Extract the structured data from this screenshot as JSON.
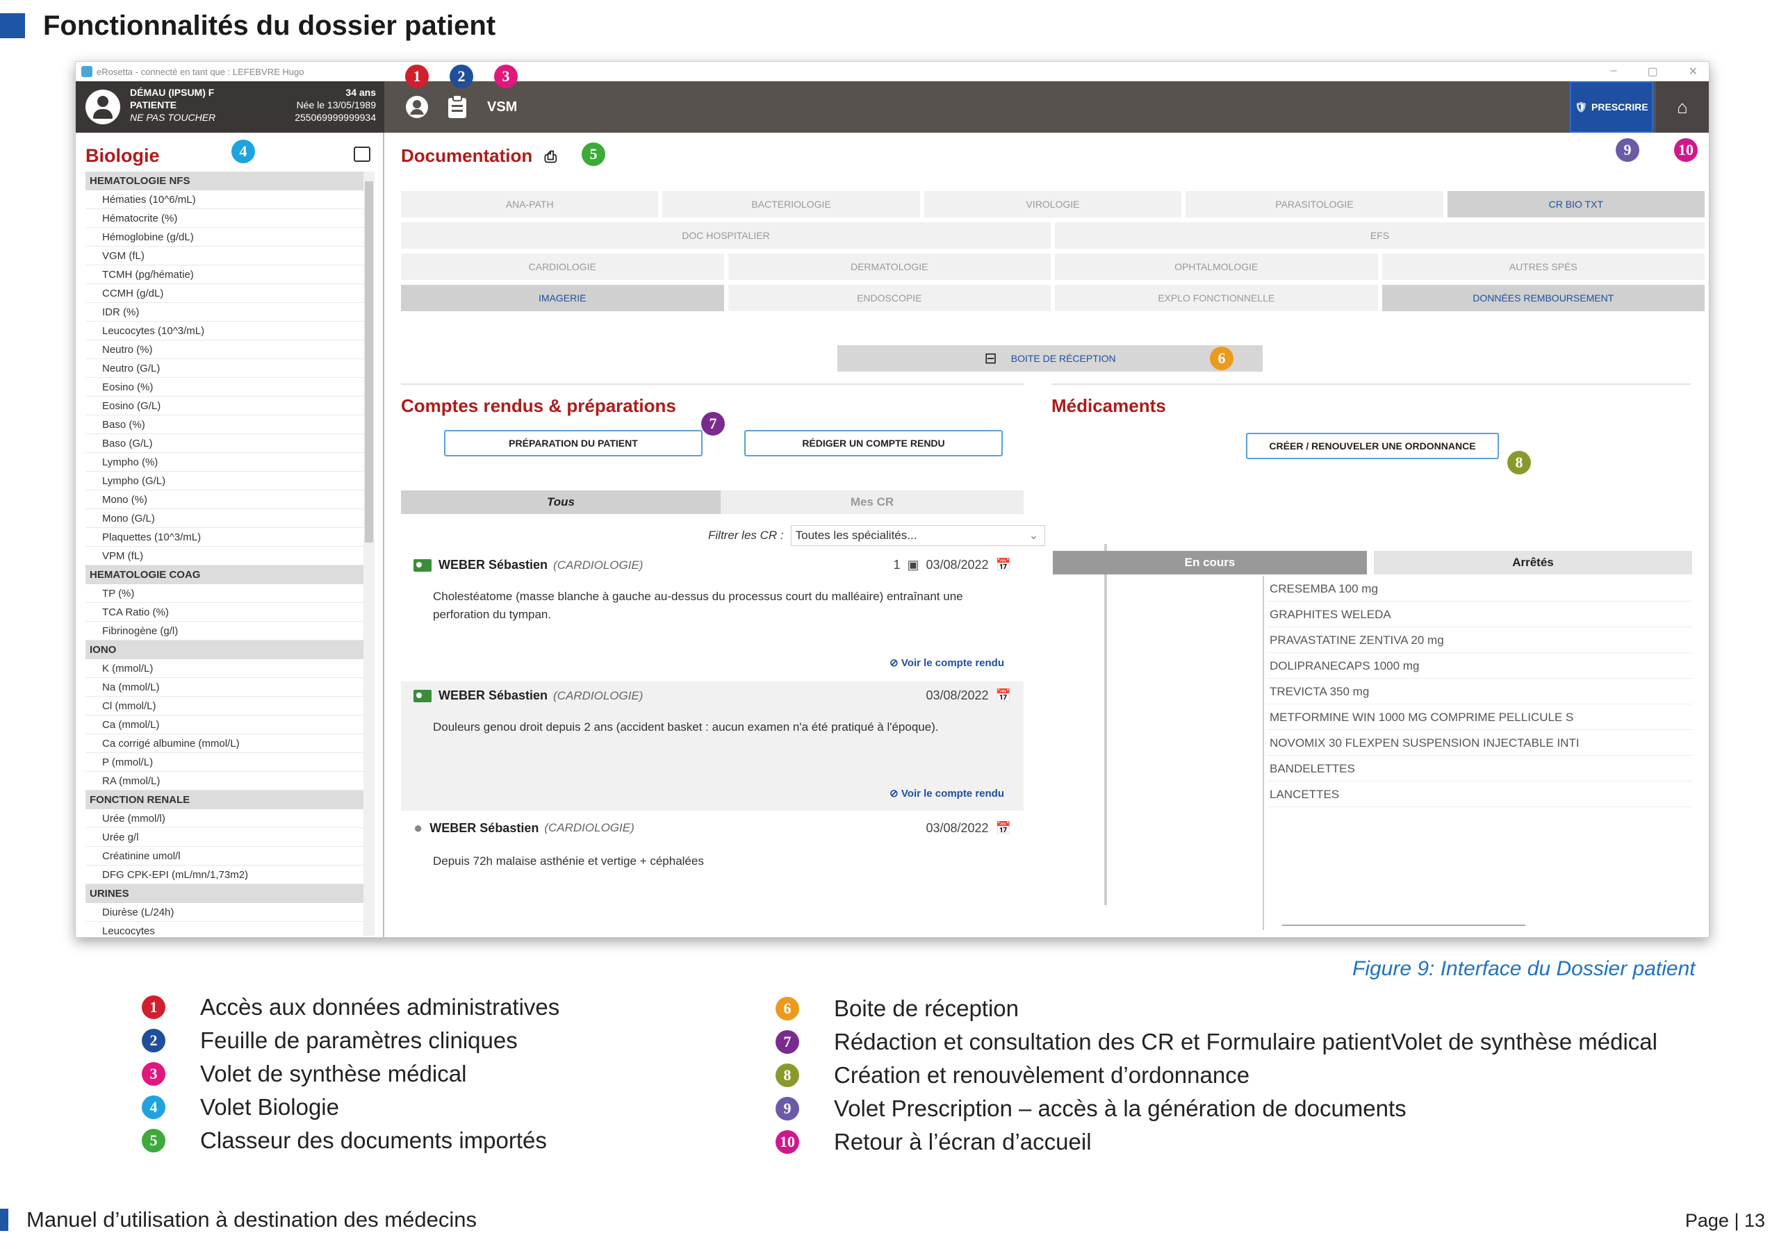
{
  "page_title": "Fonctionnalités du dossier patient",
  "window": {
    "title": "eRosetta - connecté en tant que : LEFEBVRE Hugo",
    "min": "–",
    "max": "▢",
    "close": "✕"
  },
  "patient": {
    "name": "DÉMAU (IPSUM)  F",
    "role": "PATIENTE",
    "note": "NE PAS TOUCHER",
    "age": "34 ans",
    "birth": "Née le 13/05/1989",
    "id": "255069999999934"
  },
  "topbar": {
    "vsm": "VSM",
    "prescrire": "PRESCRIRE"
  },
  "colors": {
    "b1": "#d0202e",
    "b2": "#1f4e9c",
    "b3": "#e0187c",
    "b4": "#1ea3e0",
    "b5": "#3daa3a",
    "b6": "#ec9a1c",
    "b7": "#7a2b8e",
    "b8": "#8a9a2a",
    "b9": "#6a5aa8",
    "b10": "#d0188c"
  },
  "biology": {
    "title": "Biologie",
    "sections": [
      {
        "name": "HEMATOLOGIE NFS",
        "items": [
          "Hématies (10^6/mL)",
          "Hématocrite (%)",
          "Hémoglobine (g/dL)",
          "VGM (fL)",
          "TCMH (pg/hématie)",
          "CCMH (g/dL)",
          "IDR (%)",
          "Leucocytes (10^3/mL)",
          "Neutro (%)",
          "Neutro (G/L)",
          "Eosino (%)",
          "Eosino (G/L)",
          "Baso (%)",
          "Baso (G/L)",
          "Lympho (%)",
          "Lympho (G/L)",
          "Mono (%)",
          "Mono (G/L)",
          "Plaquettes (10^3/mL)",
          "VPM (fL)"
        ]
      },
      {
        "name": "HEMATOLOGIE COAG",
        "items": [
          "TP (%)",
          "TCA Ratio (%)",
          "Fibrinogène (g/l)"
        ]
      },
      {
        "name": "IONO",
        "items": [
          "K (mmol/L)",
          "Na (mmol/L)",
          "Cl (mmol/L)",
          "Ca (mmol/L)",
          "Ca corrigé albumine (mmol/L)",
          "P (mmol/L)",
          "RA (mmol/L)"
        ]
      },
      {
        "name": "FONCTION RENALE",
        "items": [
          "Urée (mmol/l)",
          "Urée g/l",
          "Créatinine umol/l",
          "DFG CPK-EPI (mL/mn/1,73m2)"
        ]
      },
      {
        "name": "URINES",
        "items": [
          "Diurèse (L/24h)",
          "Leucocytes"
        ]
      }
    ]
  },
  "documentation": {
    "title": "Documentation",
    "tabs_row1": [
      "ANA-PATH",
      "BACTERIOLOGIE",
      "VIROLOGIE",
      "PARASITOLOGIE",
      "CR BIO TXT"
    ],
    "tabs_row2": [
      "DOC HOSPITALIER",
      "EFS"
    ],
    "tabs_row3": [
      "CARDIOLOGIE",
      "DERMATOLOGIE",
      "OPHTALMOLOGIE",
      "AUTRES SPÉS"
    ],
    "tabs_row4": [
      "IMAGERIE",
      "ENDOSCOPIE",
      "EXPLO FONCTIONNELLE",
      "DONNÉES REMBOURSEMENT"
    ],
    "inbox": "BOITE DE RÉCEPTION"
  },
  "comptes_rendus": {
    "title": "Comptes rendus & préparations",
    "btn_prep": "PRÉPARATION DU PATIENT",
    "btn_rediger": "RÉDIGER UN COMPTE RENDU",
    "tab_tous": "Tous",
    "tab_mes": "Mes CR",
    "filter_label": "Filtrer les CR :",
    "filter_value": "Toutes les spécialités...",
    "items": [
      {
        "author": "WEBER Sébastien",
        "spec": "(CARDIOLOGIE)",
        "count": "1",
        "date": "03/08/2022",
        "text": "Cholestéatome (masse blanche à gauche au-dessus du processus court du malléaire) entraînant une perforation du tympan.",
        "voir": "Voir le compte rendu"
      },
      {
        "author": "WEBER Sébastien",
        "spec": "(CARDIOLOGIE)",
        "date": "03/08/2022",
        "text": "Douleurs genou droit depuis 2 ans (accident basket : aucun examen n'a été pratiqué à l'époque).",
        "voir": "Voir le compte rendu"
      },
      {
        "author": "WEBER Sébastien",
        "spec": "(CARDIOLOGIE)",
        "date": "03/08/2022",
        "text": "Depuis 72h malaise asthénie et vertige + céphalées"
      }
    ]
  },
  "medicaments": {
    "title": "Médicaments",
    "btn": "CRÉER / RENOUVELER UNE ORDONNANCE",
    "tab_cours": "En cours",
    "tab_arretes": "Arrêtés",
    "arretes": [
      "CRESEMBA 100 mg",
      "GRAPHITES WELEDA",
      "PRAVASTATINE ZENTIVA 20 mg",
      "DOLIPRANECAPS 1000 mg",
      "TREVICTA 350 mg",
      "METFORMINE WIN 1000 MG COMPRIME PELLICULE S",
      "NOVOMIX 30 FLEXPEN SUSPENSION INJECTABLE INTI",
      "BANDELETTES",
      "LANCETTES"
    ]
  },
  "caption": "Figure 9: Interface du Dossier patient",
  "legend": [
    {
      "n": "1",
      "text": "Accès aux données administratives"
    },
    {
      "n": "2",
      "text": "Feuille de paramètres cliniques"
    },
    {
      "n": "3",
      "text": "Volet de synthèse médical"
    },
    {
      "n": "4",
      "text": "Volet Biologie"
    },
    {
      "n": "5",
      "text": "Classeur des documents importés"
    },
    {
      "n": "6",
      "text": "Boite de réception"
    },
    {
      "n": "7",
      "text": "Rédaction et consultation des CR et Formulaire patientVolet de synthèse médical"
    },
    {
      "n": "8",
      "text": "Création et renouvèlement d’ordonnance"
    },
    {
      "n": "9",
      "text": "Volet Prescription – accès à la génération de documents"
    },
    {
      "n": "10",
      "text": "Retour à l’écran d’accueil"
    }
  ],
  "footer": {
    "text": "Manuel d’utilisation à destination des médecins",
    "page": "Page  |  13"
  }
}
